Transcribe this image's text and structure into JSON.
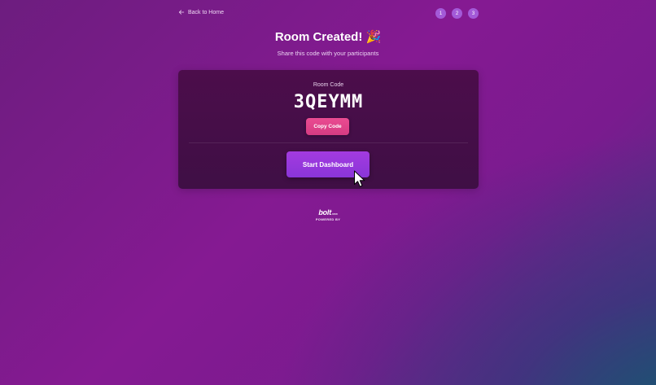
{
  "nav": {
    "back_label": "Back to Home"
  },
  "steps": [
    "1",
    "2",
    "3"
  ],
  "header": {
    "title": "Room Created! 🎉",
    "subtitle": "Share this code with your participants"
  },
  "room": {
    "code_label": "Room Code",
    "code": "3QEYMM",
    "copy_label": "Copy Code",
    "start_label": "Start Dashboard"
  },
  "badge": {
    "logo": "bolt",
    "logo_suffix": ".new",
    "powered_by": "POWERED BY"
  },
  "colors": {
    "copy_button": "#e0448a",
    "start_button": "#9a38dc",
    "step_circle": "#a35ad8",
    "card": "#470e48"
  }
}
